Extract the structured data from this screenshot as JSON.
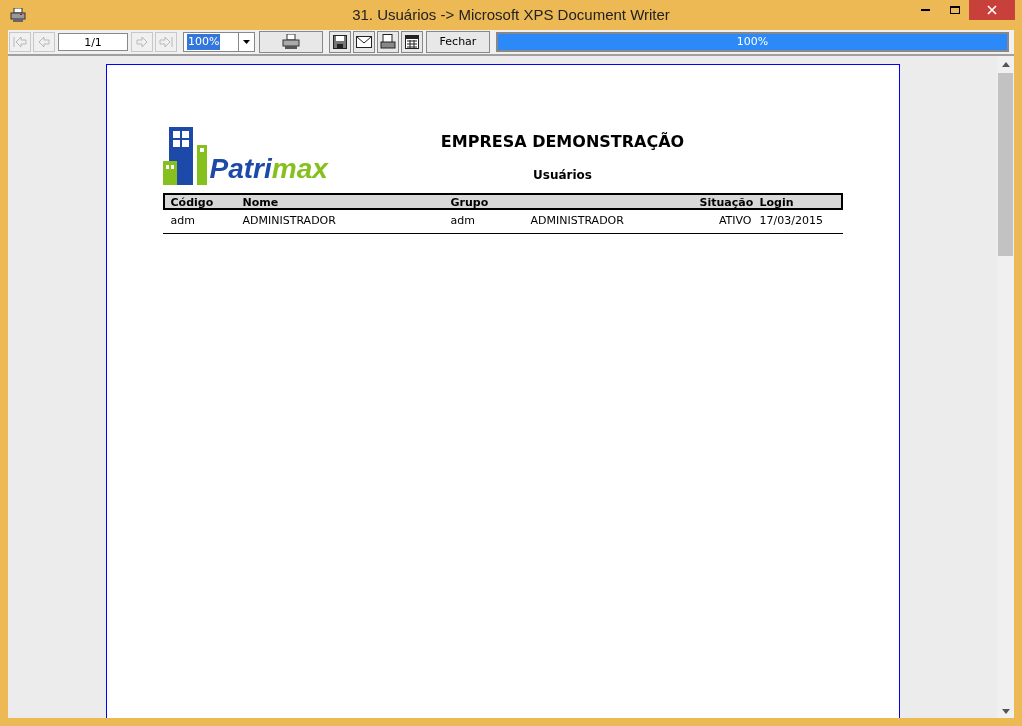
{
  "window": {
    "title": "31. Usuários -> Microsoft XPS Document Writer"
  },
  "toolbar": {
    "nav_buttons": [
      {
        "kind": "first",
        "disabled": true
      },
      {
        "kind": "prev",
        "disabled": true
      }
    ],
    "page_field": "1/1",
    "nav_buttons_after": [
      {
        "kind": "next",
        "disabled": true
      },
      {
        "kind": "last",
        "disabled": true
      }
    ],
    "zoom": {
      "value": "100%",
      "selected": true
    },
    "close_button": "Fechar",
    "progress": {
      "level": 1,
      "reading": "100%"
    }
  },
  "report": {
    "logo_text": [
      "Patri",
      "max"
    ],
    "company": "EMPRESA DEMONSTRAÇÃO",
    "title": "Usuários",
    "table": {
      "columns": [
        "Código",
        "Nome",
        "Grupo",
        "",
        "Situação",
        "Login"
      ],
      "rows": [
        [
          "adm",
          "ADMINISTRADOR",
          "adm",
          "ADMINISTRADOR",
          "ATIVO",
          "17/03/2015"
        ]
      ]
    }
  }
}
